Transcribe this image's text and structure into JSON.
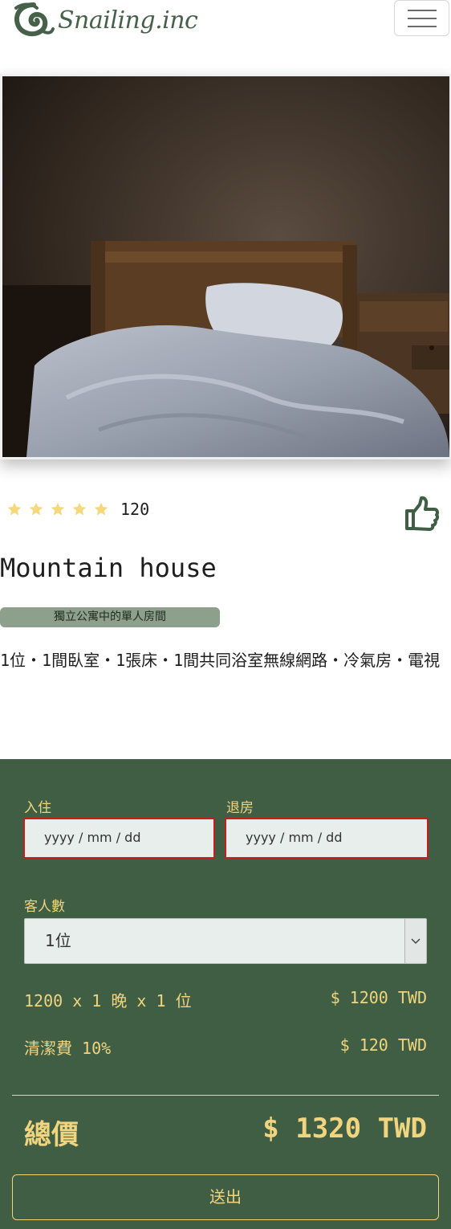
{
  "brand": {
    "name": "Snailing.inc",
    "accent": "#47604a"
  },
  "nav": {
    "toggle_icon": "hamburger-icon"
  },
  "room": {
    "rating_stars": 5,
    "rating_count": "120",
    "like_icon": "thumbs-up-icon",
    "title": "Mountain house",
    "tag": "獨立公寓中的單人房間",
    "amenities": "1位・1間臥室・1張床・1間共同浴室無線網路・冷氣房・電視"
  },
  "booking": {
    "checkin_label": "入住",
    "checkout_label": "退房",
    "checkin_placeholder": "yyyy / mm / dd",
    "checkout_placeholder": "yyyy / mm / dd",
    "guests_label": "客人數",
    "guests_selected": "1位",
    "price_line": "1200 x 1 晚 x 1 位",
    "price_amount": "$ 1200 TWD",
    "fee_line": "清潔費 10%",
    "fee_amount": "$ 120 TWD",
    "total_label": "總價",
    "total_amount": "$ 1320 TWD",
    "submit_label": "送出",
    "bg_color": "#3f5e44",
    "text_color": "#f1d57e"
  }
}
